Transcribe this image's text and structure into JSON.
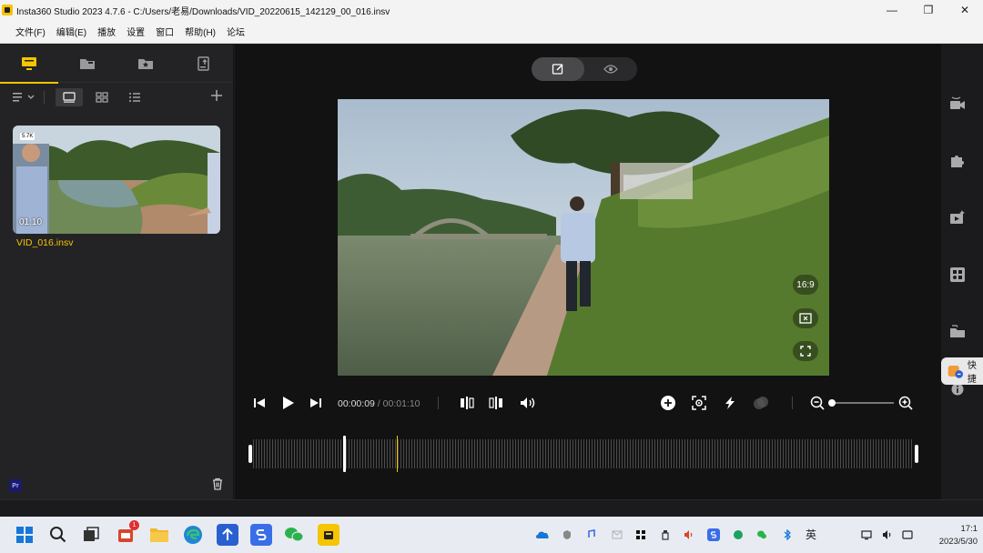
{
  "window": {
    "title": "Insta360 Studio 2023 4.7.6 - C:/Users/老易/Downloads/VID_20220615_142129_00_016.insv",
    "minimize": "—",
    "maximize": "❐",
    "close": "✕"
  },
  "menu": [
    "文件(F)",
    "编辑(E)",
    "播放",
    "设置",
    "窗口",
    "帮助(H)",
    "论坛"
  ],
  "library": {
    "clip": {
      "duration": "01:10",
      "name": "VID_016.insv",
      "badge": "5.7K"
    },
    "pr_label": "Pr"
  },
  "player": {
    "current_time": "00:00:09",
    "separator": " / ",
    "total_time": "00:01:10",
    "aspect_label": "16:9",
    "zoom_level": 0
  },
  "sidebar": {
    "quick_label": "快捷"
  },
  "taskbar": {
    "lang": "英",
    "date": "2023/5/30",
    "time": "17:1",
    "notification_count": "1"
  },
  "colors": {
    "accent": "#f6c400",
    "background": "#121212"
  }
}
